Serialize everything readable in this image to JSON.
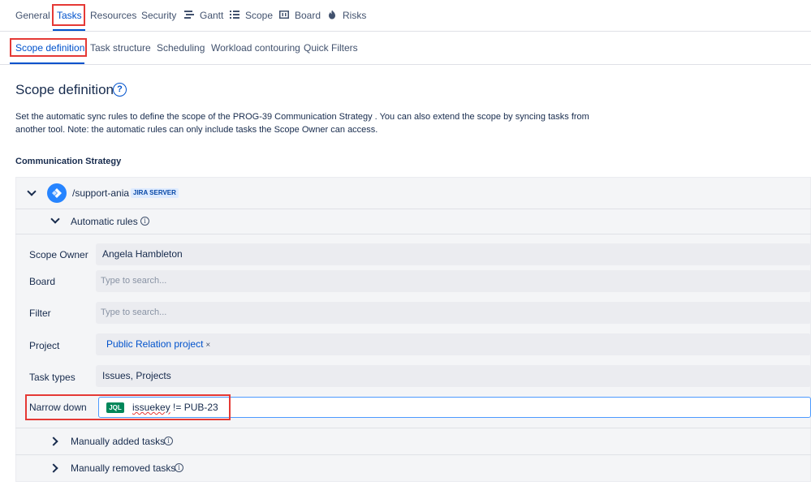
{
  "top_tabs": {
    "general": "General",
    "tasks": "Tasks",
    "resources": "Resources",
    "security": "Security",
    "gantt": "Gantt",
    "scope": "Scope",
    "board": "Board",
    "risks": "Risks"
  },
  "sub_tabs": {
    "scope_definition": "Scope definition",
    "task_structure": "Task structure",
    "scheduling": "Scheduling",
    "workload_contouring": "Workload contouring",
    "quick_filters": "Quick Filters"
  },
  "page": {
    "title": "Scope definition",
    "help": "?",
    "description": "Set the automatic sync rules to define the scope of the PROG-39 Communication Strategy . You can also extend the scope by syncing tasks from another tool. Note: the automatic rules can only include tasks the Scope Owner can access.",
    "section_label": "Communication Strategy"
  },
  "source": {
    "name": "/support-ania",
    "badge": "JIRA SERVER"
  },
  "automatic_rules": {
    "label": "Automatic rules",
    "fields": {
      "scope_owner_label": "Scope Owner",
      "scope_owner_value": "Angela Hambleton",
      "board_label": "Board",
      "board_placeholder": "Type to search...",
      "filter_label": "Filter",
      "filter_placeholder": "Type to search...",
      "project_label": "Project",
      "project_tag": "Public Relation project",
      "project_tag_remove": "×",
      "task_types_label": "Task types",
      "task_types_value": "Issues, Projects",
      "narrow_down_label": "Narrow down",
      "jql_chip": "JQL",
      "jql_field": "issuekey",
      "jql_rest": " != PUB-23"
    }
  },
  "manually_added": {
    "label": "Manually added tasks"
  },
  "manually_removed": {
    "label": "Manually removed tasks"
  },
  "colors": {
    "accent": "#0052cc",
    "highlight_box": "#e53935",
    "jql_chip": "#00875a",
    "panel_bg": "#f4f5f7"
  }
}
